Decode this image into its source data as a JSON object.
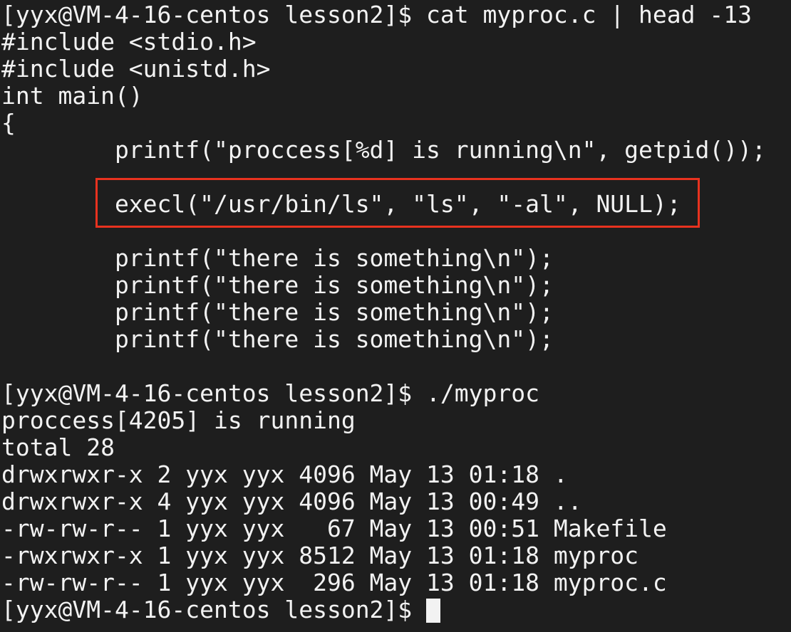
{
  "terminal": {
    "lines": [
      "[yyx@VM-4-16-centos lesson2]$ cat myproc.c | head -13",
      "#include <stdio.h>",
      "#include <unistd.h>",
      "int main()",
      "{",
      "        printf(\"proccess[%d] is running\\n\", getpid());",
      "",
      "        execl(\"/usr/bin/ls\", \"ls\", \"-al\", NULL);",
      "",
      "        printf(\"there is something\\n\");",
      "        printf(\"there is something\\n\");",
      "        printf(\"there is something\\n\");",
      "        printf(\"there is something\\n\");",
      "",
      "[yyx@VM-4-16-centos lesson2]$ ./myproc",
      "proccess[4205] is running",
      "total 28",
      "drwxrwxr-x 2 yyx yyx 4096 May 13 01:18 .",
      "drwxrwxr-x 4 yyx yyx 4096 May 13 00:49 ..",
      "-rw-rw-r-- 1 yyx yyx   67 May 13 00:51 Makefile",
      "-rwxrwxr-x 1 yyx yyx 8512 May 13 01:18 myproc",
      "-rw-rw-r-- 1 yyx yyx  296 May 13 01:18 myproc.c"
    ],
    "prompt": "[yyx@VM-4-16-centos lesson2]$ ",
    "colors": {
      "background": "#1e1e1e",
      "foreground": "#f2f2f2",
      "highlight_border": "#e8321f"
    }
  }
}
